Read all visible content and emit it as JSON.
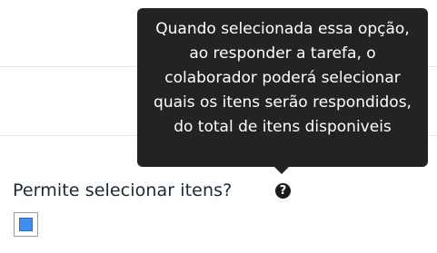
{
  "field": {
    "label": "Permite selecionar itens?",
    "checkbox_checked": true,
    "help_icon": "question-circle-icon",
    "help_icon_glyph": "?"
  },
  "tooltip": {
    "text": "Quando selecionada essa opção, ao responder a tarefa, o colaborador poderá selecionar quais os itens serão respondidos, do total de itens disponiveis"
  },
  "colors": {
    "tooltip_bg": "#232323",
    "checkbox_fill": "#3f8ef0",
    "label_text": "#1f2733"
  }
}
